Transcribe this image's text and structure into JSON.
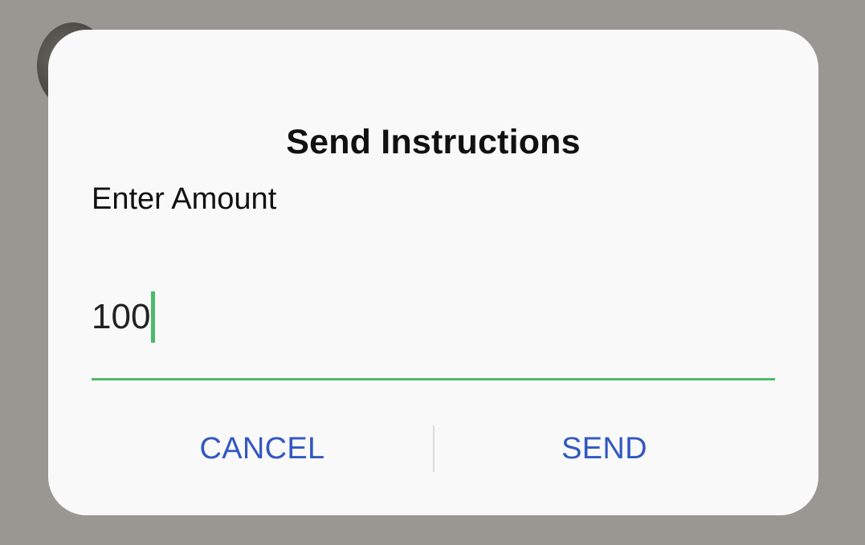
{
  "dialog": {
    "title": "Send Instructions",
    "field_label": "Enter Amount",
    "amount_value": "100",
    "cancel_label": "CANCEL",
    "send_label": "SEND"
  },
  "colors": {
    "accent": "#4cbb6a",
    "button_text": "#3258c0",
    "dialog_bg": "#f9f9f9",
    "scrim": "#989792"
  }
}
